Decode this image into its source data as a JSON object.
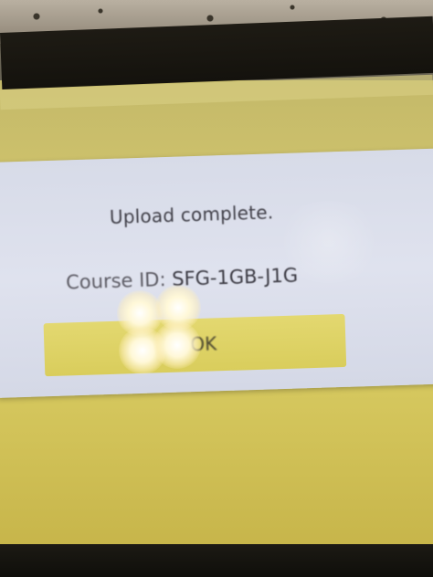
{
  "dialog": {
    "message": "Upload complete.",
    "course_label": "Course ID:",
    "course_id": "SFG-1GB-J1G",
    "ok_label": "OK"
  },
  "colors": {
    "screen_background": "#d2c66c",
    "dialog_background": "#dfe2ee",
    "button_background": "#e3d870",
    "text": "#403f48"
  }
}
